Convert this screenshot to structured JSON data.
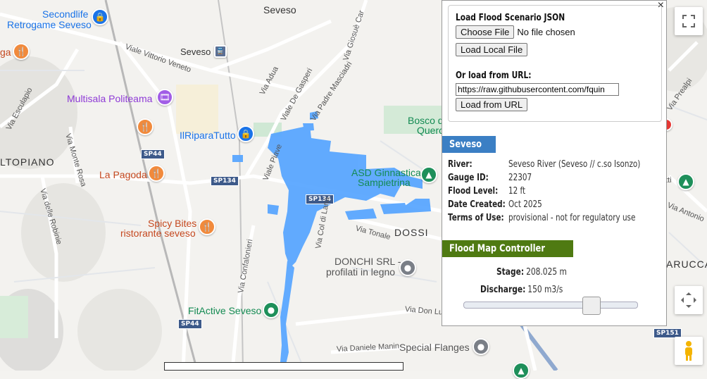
{
  "map": {
    "town_labels": [
      "Seveso",
      "Seveso",
      "LTOPIANO",
      "DOSSI",
      "ARUCCA"
    ],
    "poi": {
      "secondlife": [
        "Secondlife",
        "Retrogame Seveso"
      ],
      "multisala": "Multisala Politeama",
      "ilriparatutto": "IlRiparaTutto",
      "lapagoda": "La Pagoda",
      "spicybites": [
        "Spicy Bites",
        "ristorante seveso"
      ],
      "bosco": [
        "Bosco d",
        "Querc"
      ],
      "asd": [
        "ASD Ginnastica",
        "Sampietrina"
      ],
      "donchi": [
        "DONCHI SRL -",
        "profilati in legno"
      ],
      "fitactive": "FitActive Seveso",
      "specialflanges": "Special Flanges",
      "ga": "ga"
    },
    "streets": {
      "vittorio_veneto": "Viale Vittorio Veneto",
      "adua": "Via Adua",
      "de_gasperi": "Viale De Gasperi",
      "mascia": "Via Padre Masciadri",
      "giosue": "Via Giosuè Car",
      "esculapio": "Via Esculapio",
      "monte_rosa": "Via Monte Rosa",
      "robinie": "Via delle Robinie",
      "piave": "Viale Piave",
      "col_di_lana": "Via Col di Lana",
      "tonale": "Via Tonale",
      "confalonieri": "Via Confalonieri",
      "don_lu": "Via Don Lu",
      "daniele_manin": "Via Daniele Manin",
      "prealpi": "Via Prealpi",
      "antonio": "Via Antonio",
      "tti": "tti"
    },
    "shields": [
      "SP44",
      "SP134",
      "SP134",
      "SP44",
      "SP151"
    ]
  },
  "controls": {
    "fullscreen_icon": "fullscreen-icon",
    "camera_icon": "camera-control-icon",
    "pegman_icon": "pegman-icon"
  },
  "panel": {
    "close_label": "×",
    "load": {
      "title": "Load Flood Scenario JSON",
      "choose_file": "Choose File",
      "file_status": "No file chosen",
      "load_local": "Load Local File",
      "url_label": "Or load from URL:",
      "url_value": "https://raw.githubusercontent.com/fquin",
      "load_url": "Load from URL"
    },
    "site": {
      "name": "Seveso",
      "rows": [
        {
          "k": "River:",
          "v": "Seveso River (Seveso // c.so Isonzo)"
        },
        {
          "k": "Gauge ID:",
          "v": "22307"
        },
        {
          "k": "Flood Level:",
          "v": "12 ft"
        },
        {
          "k": "Date Created:",
          "v": "Oct 2025"
        },
        {
          "k": "Terms of Use:",
          "v": "provisional - not for regulatory use"
        }
      ]
    },
    "controller": {
      "title": "Flood Map Controller",
      "stage_label": "Stage:",
      "stage_value": "208.025 m",
      "discharge_label": "Discharge:",
      "discharge_value": "150 m3/s",
      "slider_fraction": 0.76
    }
  },
  "colors": {
    "flood": "#5aa7ff",
    "site_badge": "#3b7fc4",
    "controller_badge": "#4f7a12"
  }
}
